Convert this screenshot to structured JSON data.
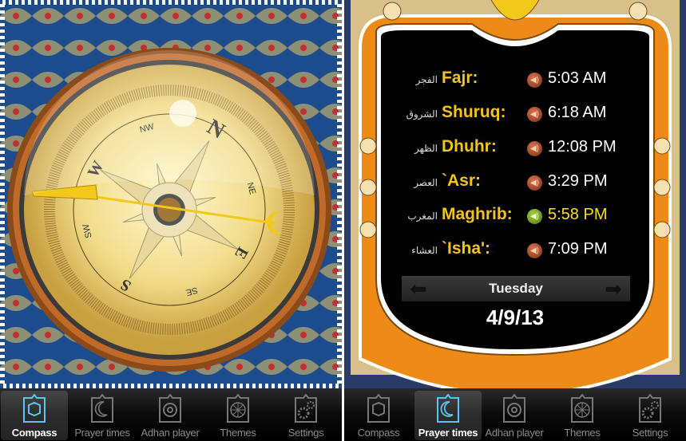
{
  "tabs": [
    {
      "label": "Compass",
      "icon": "kaaba-icon"
    },
    {
      "label": "Prayer times",
      "icon": "crescent-star-icon"
    },
    {
      "label": "Adhan player",
      "icon": "speaker-icon"
    },
    {
      "label": "Themes",
      "icon": "compass-rose-icon"
    },
    {
      "label": "Settings",
      "icon": "gear-icon"
    }
  ],
  "compass": {
    "selected_tab": "Compass",
    "cardinals": [
      "N",
      "E",
      "S",
      "W"
    ],
    "intercardinals": [
      "NE",
      "SE",
      "SW",
      "NW"
    ],
    "heading_deg": 30,
    "qibla_pointer": "crescent-icon",
    "colors": {
      "dial": "#f2dc8a",
      "ring": "#b5652a",
      "needle": "#f2c81a"
    }
  },
  "prayer": {
    "selected_tab": "Prayer times",
    "rows": [
      {
        "arabic": "الفجر",
        "name": "Fajr:",
        "time": "5:03 AM",
        "active": false
      },
      {
        "arabic": "الشروق",
        "name": "Shuruq:",
        "time": "6:18 AM",
        "active": false
      },
      {
        "arabic": "الظهر",
        "name": "Dhuhr:",
        "time": "12:08 PM",
        "active": false
      },
      {
        "arabic": "العصر",
        "name": "`Asr:",
        "time": "3:29 PM",
        "active": false
      },
      {
        "arabic": "المغرب",
        "name": "Maghrib:",
        "time": "5:58 PM",
        "active": true
      },
      {
        "arabic": "العشاء",
        "name": "`Isha':",
        "time": "7:09 PM",
        "active": false
      }
    ],
    "day": "Tuesday",
    "date": "4/9/13",
    "colors": {
      "name": "#f3c51a",
      "active_time": "#f5e020"
    }
  }
}
